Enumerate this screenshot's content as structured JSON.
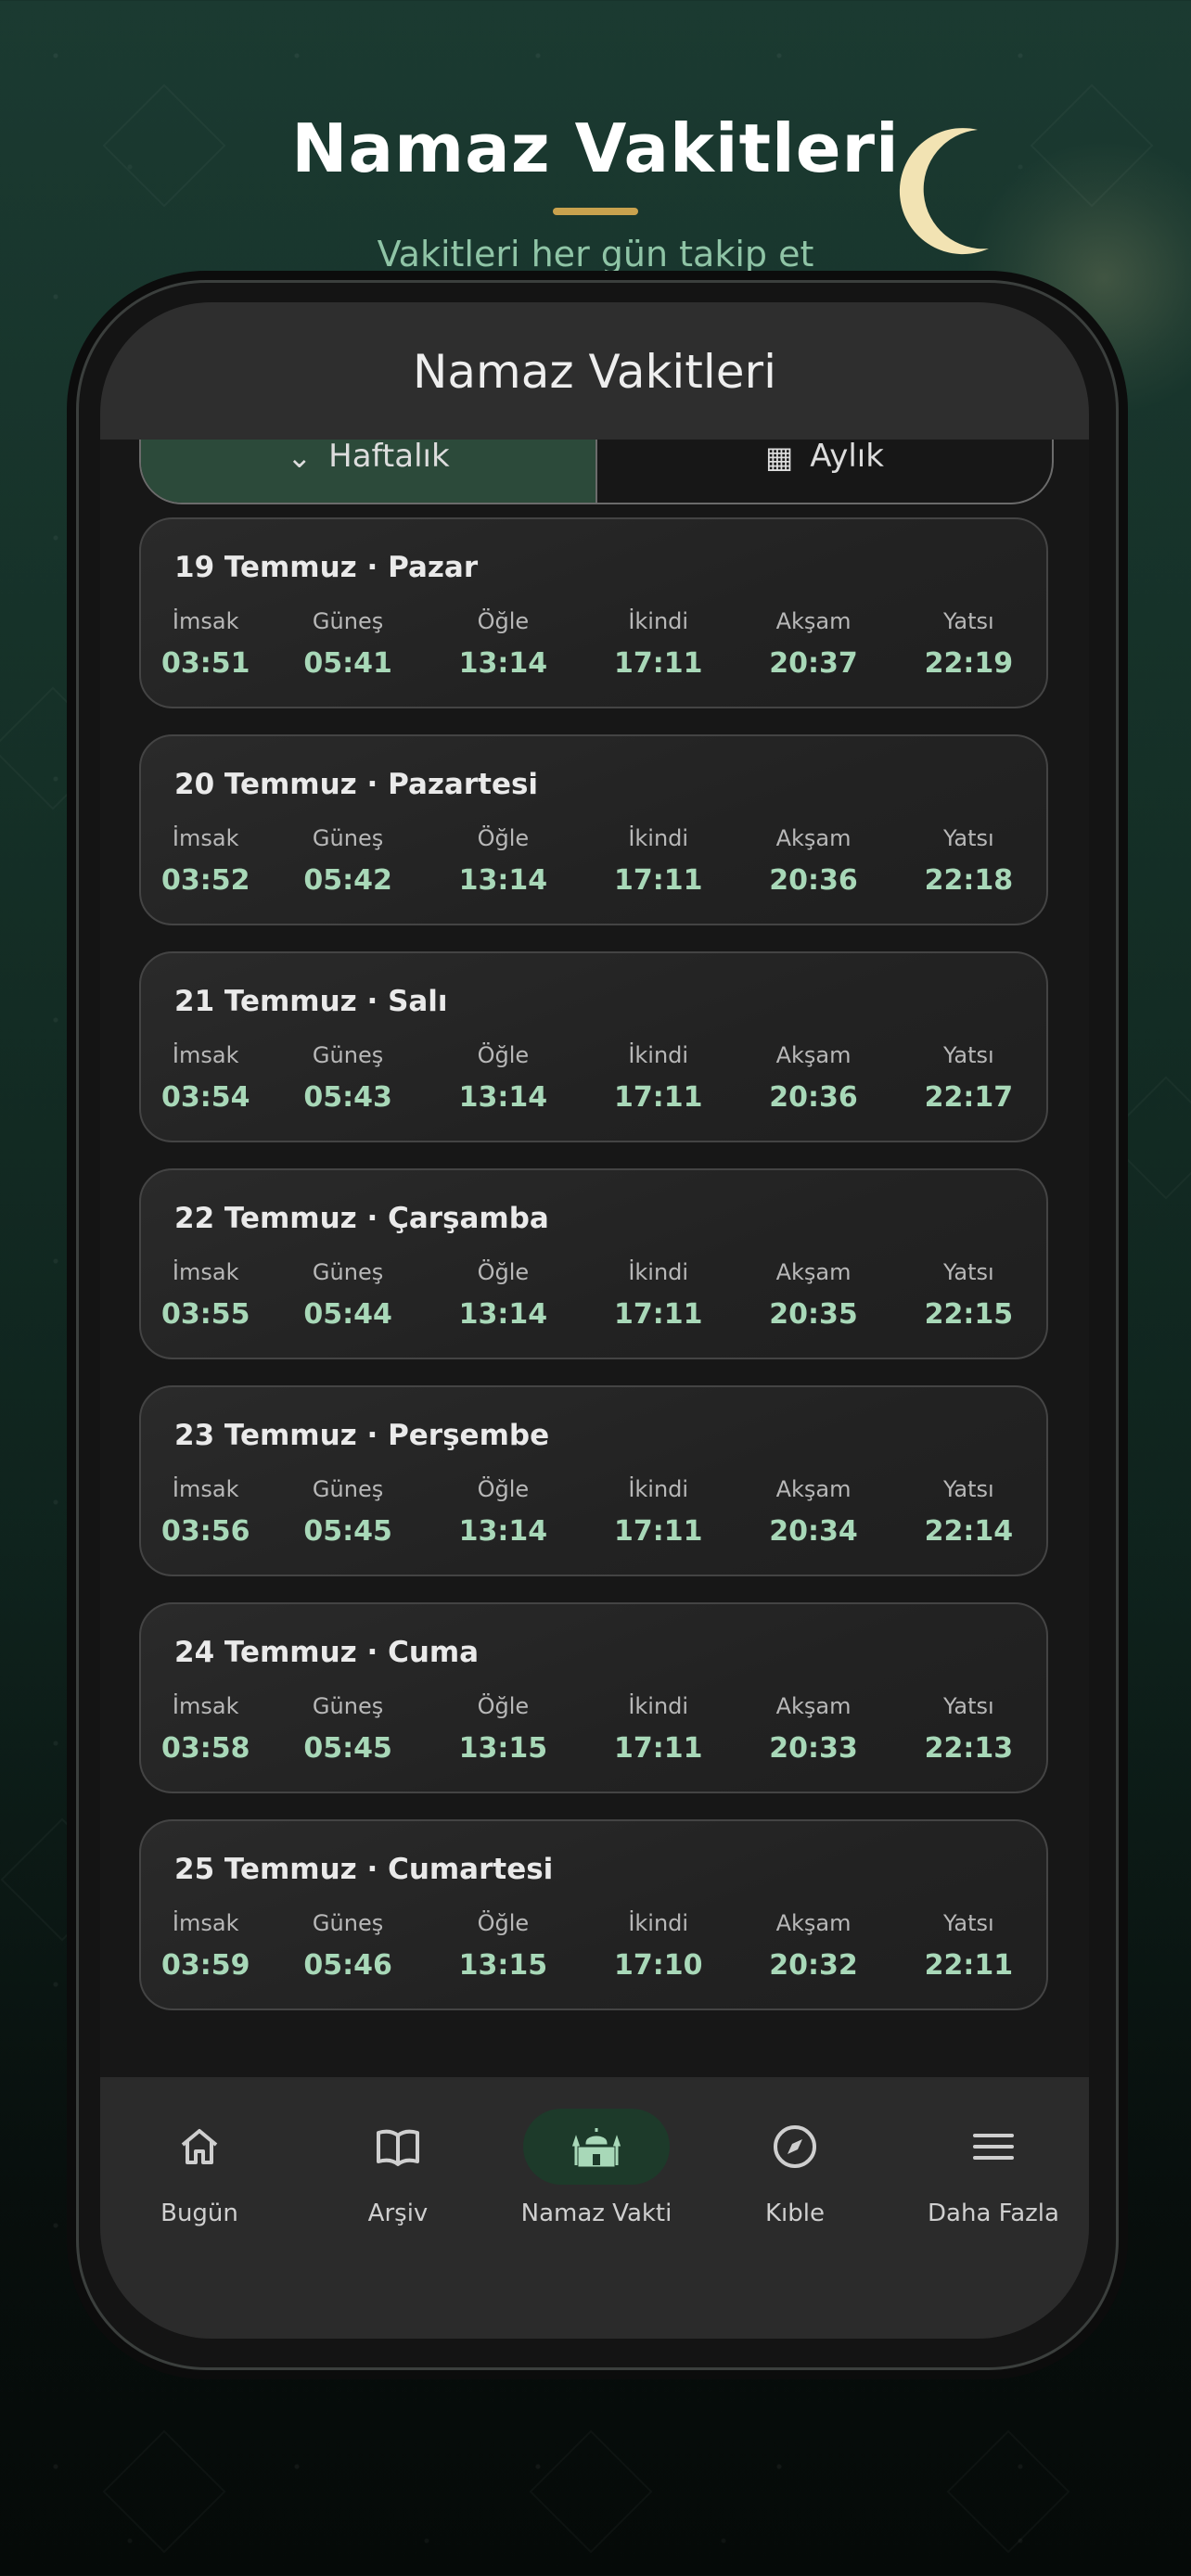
{
  "header": {
    "title": "Namaz Vakitleri",
    "subtitle": "Vakitleri her gün takip et"
  },
  "app": {
    "title": "Namaz Vakitleri",
    "segments": [
      {
        "label": "Haftalık",
        "icon": "chevron-down-icon",
        "active": true
      },
      {
        "label": "Aylık",
        "icon": "calendar-icon",
        "active": false
      }
    ]
  },
  "prayer_labels": [
    "İmsak",
    "Güneş",
    "Öğle",
    "İkindi",
    "Akşam",
    "Yatsı"
  ],
  "days": [
    {
      "title": "19 Temmuz · Pazar",
      "times": [
        "03:51",
        "05:41",
        "13:14",
        "17:11",
        "20:37",
        "22:19"
      ]
    },
    {
      "title": "20 Temmuz · Pazartesi",
      "times": [
        "03:52",
        "05:42",
        "13:14",
        "17:11",
        "20:36",
        "22:18"
      ]
    },
    {
      "title": "21 Temmuz · Salı",
      "times": [
        "03:54",
        "05:43",
        "13:14",
        "17:11",
        "20:36",
        "22:17"
      ]
    },
    {
      "title": "22 Temmuz · Çarşamba",
      "times": [
        "03:55",
        "05:44",
        "13:14",
        "17:11",
        "20:35",
        "22:15"
      ]
    },
    {
      "title": "23 Temmuz · Perşembe",
      "times": [
        "03:56",
        "05:45",
        "13:14",
        "17:11",
        "20:34",
        "22:14"
      ]
    },
    {
      "title": "24 Temmuz · Cuma",
      "times": [
        "03:58",
        "05:45",
        "13:15",
        "17:11",
        "20:33",
        "22:13"
      ]
    },
    {
      "title": "25 Temmuz · Cumartesi",
      "times": [
        "03:59",
        "05:46",
        "13:15",
        "17:10",
        "20:32",
        "22:11"
      ]
    }
  ],
  "nav": [
    {
      "label": "Bugün",
      "icon": "home-icon",
      "active": false
    },
    {
      "label": "Arşiv",
      "icon": "book-icon",
      "active": false
    },
    {
      "label": "Namaz Vakti",
      "icon": "mosque-icon",
      "active": true
    },
    {
      "label": "Kıble",
      "icon": "compass-icon",
      "active": false
    },
    {
      "label": "Daha Fazla",
      "icon": "menu-icon",
      "active": false
    }
  ],
  "colors": {
    "accent_green": "#a8d8b8",
    "active_tab_bg": "#1d3a2a",
    "gold": "#c9a24e",
    "moon": "#f2e3b3"
  }
}
